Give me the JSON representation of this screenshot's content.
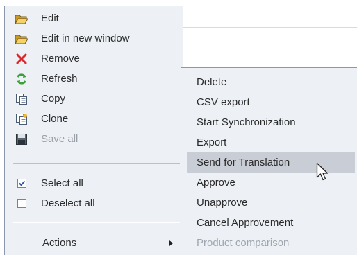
{
  "context_menu": {
    "items": [
      {
        "label": "Edit",
        "icon": "folder-open-icon",
        "disabled": false
      },
      {
        "label": "Edit in new window",
        "icon": "folder-open-icon",
        "disabled": false
      },
      {
        "label": "Remove",
        "icon": "red-x-icon",
        "disabled": false
      },
      {
        "label": "Refresh",
        "icon": "refresh-icon",
        "disabled": false
      },
      {
        "label": "Copy",
        "icon": "copy-icon",
        "disabled": false
      },
      {
        "label": "Clone",
        "icon": "clone-icon",
        "disabled": false
      },
      {
        "label": "Save all",
        "icon": "save-icon",
        "disabled": true
      }
    ],
    "selection": [
      {
        "label": "Select all",
        "checked": true
      },
      {
        "label": "Deselect all",
        "checked": false
      }
    ],
    "actions_label": "Actions"
  },
  "actions_submenu": {
    "items": [
      {
        "label": "Delete",
        "highlighted": false,
        "disabled": false
      },
      {
        "label": "CSV export",
        "highlighted": false,
        "disabled": false
      },
      {
        "label": "Start Synchronization",
        "highlighted": false,
        "disabled": false
      },
      {
        "label": "Export",
        "highlighted": false,
        "disabled": false
      },
      {
        "label": "Send for Translation",
        "highlighted": true,
        "disabled": false
      },
      {
        "label": "Approve",
        "highlighted": false,
        "disabled": false
      },
      {
        "label": "Unapprove",
        "highlighted": false,
        "disabled": false
      },
      {
        "label": "Cancel Approvement",
        "highlighted": false,
        "disabled": false
      },
      {
        "label": "Product comparison",
        "highlighted": false,
        "disabled": true
      }
    ]
  },
  "colors": {
    "menu_bg": "#edf1f6",
    "highlight": "#c9ced6",
    "remove_red": "#d8262a",
    "refresh_green": "#3aa13a",
    "folder_yellow": "#e8c04a",
    "check_blue": "#2a55a8"
  }
}
